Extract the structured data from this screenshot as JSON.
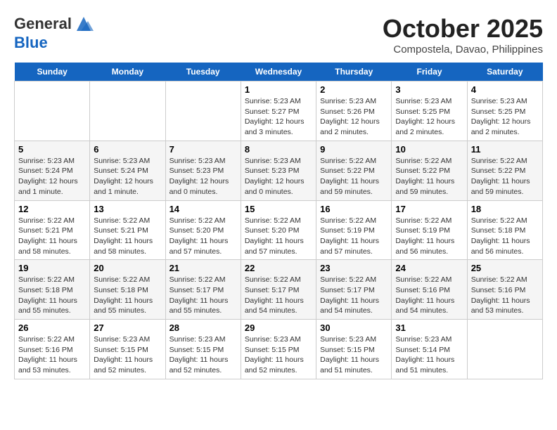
{
  "header": {
    "logo_line1": "General",
    "logo_line2": "Blue",
    "month": "October 2025",
    "location": "Compostela, Davao, Philippines"
  },
  "days_of_week": [
    "Sunday",
    "Monday",
    "Tuesday",
    "Wednesday",
    "Thursday",
    "Friday",
    "Saturday"
  ],
  "weeks": [
    [
      {
        "day": "",
        "info": ""
      },
      {
        "day": "",
        "info": ""
      },
      {
        "day": "",
        "info": ""
      },
      {
        "day": "1",
        "info": "Sunrise: 5:23 AM\nSunset: 5:27 PM\nDaylight: 12 hours and 3 minutes."
      },
      {
        "day": "2",
        "info": "Sunrise: 5:23 AM\nSunset: 5:26 PM\nDaylight: 12 hours and 2 minutes."
      },
      {
        "day": "3",
        "info": "Sunrise: 5:23 AM\nSunset: 5:25 PM\nDaylight: 12 hours and 2 minutes."
      },
      {
        "day": "4",
        "info": "Sunrise: 5:23 AM\nSunset: 5:25 PM\nDaylight: 12 hours and 2 minutes."
      }
    ],
    [
      {
        "day": "5",
        "info": "Sunrise: 5:23 AM\nSunset: 5:24 PM\nDaylight: 12 hours and 1 minute."
      },
      {
        "day": "6",
        "info": "Sunrise: 5:23 AM\nSunset: 5:24 PM\nDaylight: 12 hours and 1 minute."
      },
      {
        "day": "7",
        "info": "Sunrise: 5:23 AM\nSunset: 5:23 PM\nDaylight: 12 hours and 0 minutes."
      },
      {
        "day": "8",
        "info": "Sunrise: 5:23 AM\nSunset: 5:23 PM\nDaylight: 12 hours and 0 minutes."
      },
      {
        "day": "9",
        "info": "Sunrise: 5:22 AM\nSunset: 5:22 PM\nDaylight: 11 hours and 59 minutes."
      },
      {
        "day": "10",
        "info": "Sunrise: 5:22 AM\nSunset: 5:22 PM\nDaylight: 11 hours and 59 minutes."
      },
      {
        "day": "11",
        "info": "Sunrise: 5:22 AM\nSunset: 5:22 PM\nDaylight: 11 hours and 59 minutes."
      }
    ],
    [
      {
        "day": "12",
        "info": "Sunrise: 5:22 AM\nSunset: 5:21 PM\nDaylight: 11 hours and 58 minutes."
      },
      {
        "day": "13",
        "info": "Sunrise: 5:22 AM\nSunset: 5:21 PM\nDaylight: 11 hours and 58 minutes."
      },
      {
        "day": "14",
        "info": "Sunrise: 5:22 AM\nSunset: 5:20 PM\nDaylight: 11 hours and 57 minutes."
      },
      {
        "day": "15",
        "info": "Sunrise: 5:22 AM\nSunset: 5:20 PM\nDaylight: 11 hours and 57 minutes."
      },
      {
        "day": "16",
        "info": "Sunrise: 5:22 AM\nSunset: 5:19 PM\nDaylight: 11 hours and 57 minutes."
      },
      {
        "day": "17",
        "info": "Sunrise: 5:22 AM\nSunset: 5:19 PM\nDaylight: 11 hours and 56 minutes."
      },
      {
        "day": "18",
        "info": "Sunrise: 5:22 AM\nSunset: 5:18 PM\nDaylight: 11 hours and 56 minutes."
      }
    ],
    [
      {
        "day": "19",
        "info": "Sunrise: 5:22 AM\nSunset: 5:18 PM\nDaylight: 11 hours and 55 minutes."
      },
      {
        "day": "20",
        "info": "Sunrise: 5:22 AM\nSunset: 5:18 PM\nDaylight: 11 hours and 55 minutes."
      },
      {
        "day": "21",
        "info": "Sunrise: 5:22 AM\nSunset: 5:17 PM\nDaylight: 11 hours and 55 minutes."
      },
      {
        "day": "22",
        "info": "Sunrise: 5:22 AM\nSunset: 5:17 PM\nDaylight: 11 hours and 54 minutes."
      },
      {
        "day": "23",
        "info": "Sunrise: 5:22 AM\nSunset: 5:17 PM\nDaylight: 11 hours and 54 minutes."
      },
      {
        "day": "24",
        "info": "Sunrise: 5:22 AM\nSunset: 5:16 PM\nDaylight: 11 hours and 54 minutes."
      },
      {
        "day": "25",
        "info": "Sunrise: 5:22 AM\nSunset: 5:16 PM\nDaylight: 11 hours and 53 minutes."
      }
    ],
    [
      {
        "day": "26",
        "info": "Sunrise: 5:22 AM\nSunset: 5:16 PM\nDaylight: 11 hours and 53 minutes."
      },
      {
        "day": "27",
        "info": "Sunrise: 5:23 AM\nSunset: 5:15 PM\nDaylight: 11 hours and 52 minutes."
      },
      {
        "day": "28",
        "info": "Sunrise: 5:23 AM\nSunset: 5:15 PM\nDaylight: 11 hours and 52 minutes."
      },
      {
        "day": "29",
        "info": "Sunrise: 5:23 AM\nSunset: 5:15 PM\nDaylight: 11 hours and 52 minutes."
      },
      {
        "day": "30",
        "info": "Sunrise: 5:23 AM\nSunset: 5:15 PM\nDaylight: 11 hours and 51 minutes."
      },
      {
        "day": "31",
        "info": "Sunrise: 5:23 AM\nSunset: 5:14 PM\nDaylight: 11 hours and 51 minutes."
      },
      {
        "day": "",
        "info": ""
      }
    ]
  ]
}
